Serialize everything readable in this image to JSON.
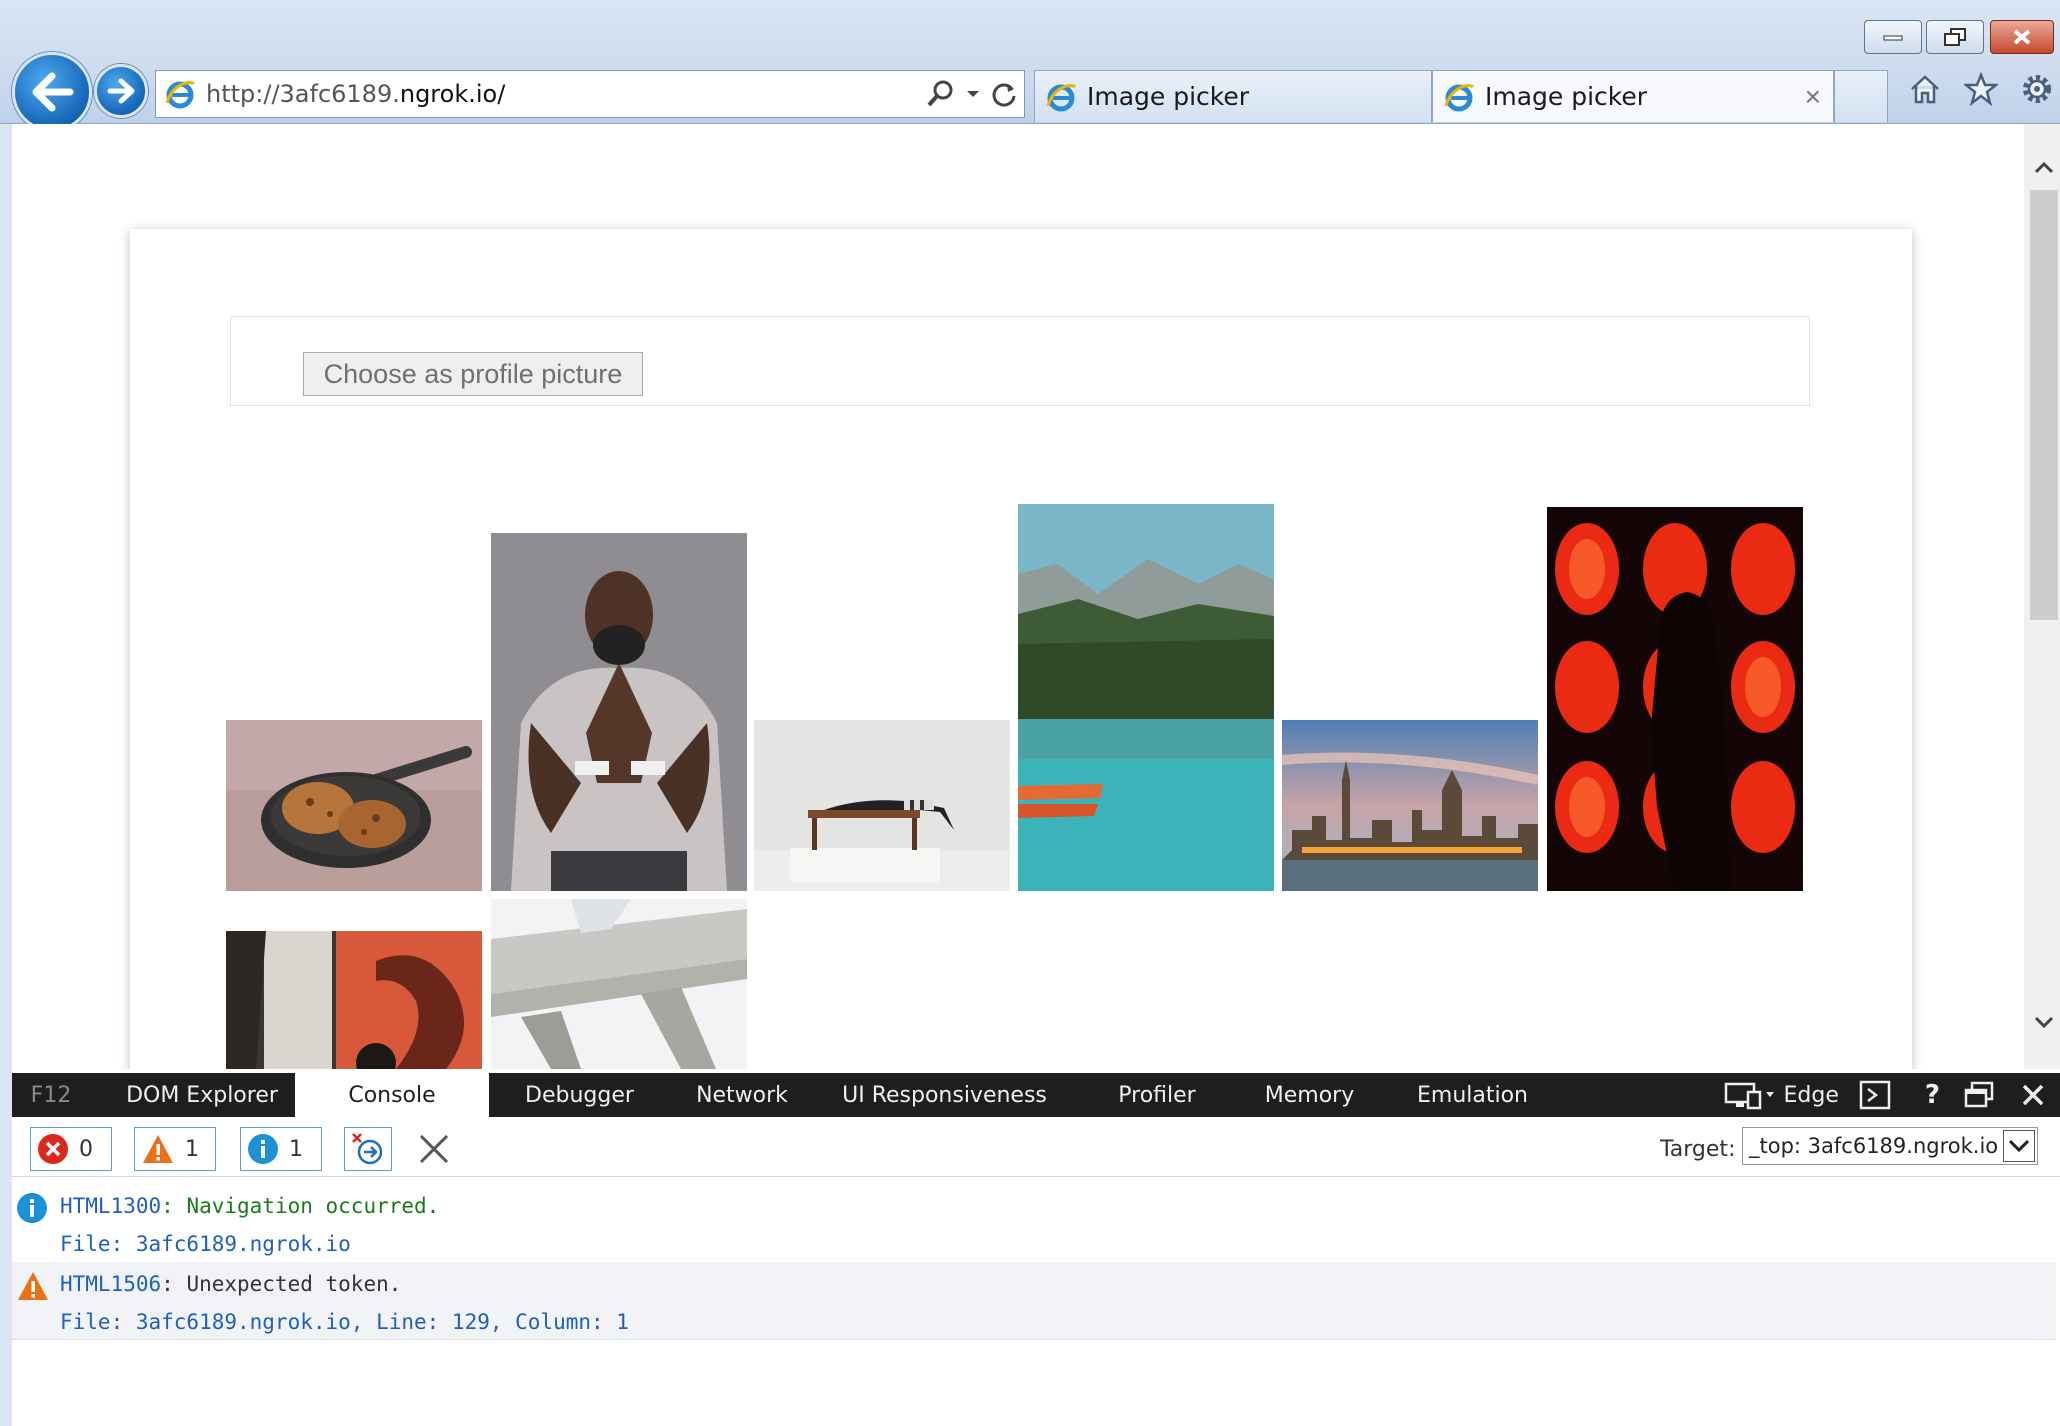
{
  "browser": {
    "url_prefix": "http://3afc6189.",
    "url_host": "ngrok.io/",
    "tabs": [
      {
        "label": "Image picker"
      },
      {
        "label": "Image picker"
      }
    ],
    "close_tab_glyph": "×"
  },
  "page": {
    "choose_button_label": "Choose as profile picture",
    "images": [
      {
        "name": "cookies-in-pan-image"
      },
      {
        "name": "man-portrait-image"
      },
      {
        "name": "person-on-table-image"
      },
      {
        "name": "mountain-lake-image"
      },
      {
        "name": "city-skyline-image"
      },
      {
        "name": "red-lanterns-image"
      },
      {
        "name": "shadow-wall-image"
      },
      {
        "name": "concrete-structure-image"
      }
    ]
  },
  "devtools": {
    "f12_label": "F12",
    "tabs": [
      "DOM Explorer",
      "Console",
      "Debugger",
      "Network",
      "UI Responsiveness",
      "Profiler",
      "Memory",
      "Emulation"
    ],
    "active_tab": "Console",
    "mode_label": "Edge",
    "help_glyph": "?",
    "filters": {
      "errors": "0",
      "warnings": "1",
      "info": "1"
    },
    "target_label": "Target:",
    "target_value": "_top: 3afc6189.ngrok.io",
    "messages": [
      {
        "type": "info",
        "code": "HTML1300",
        "text": ": Navigation occurred.",
        "location": "File: 3afc6189.ngrok.io"
      },
      {
        "type": "warning",
        "code": "HTML1506",
        "text": ": Unexpected token.",
        "location": "File: 3afc6189.ngrok.io, Line: 129, Column: 1"
      }
    ]
  },
  "colors": {
    "chrome_bg": "#cddbee",
    "devtools_tabbar": "#1e1e1e",
    "info_blue": "#1e90d6",
    "warning_orange": "#e8711a",
    "error_red": "#d9281e"
  }
}
